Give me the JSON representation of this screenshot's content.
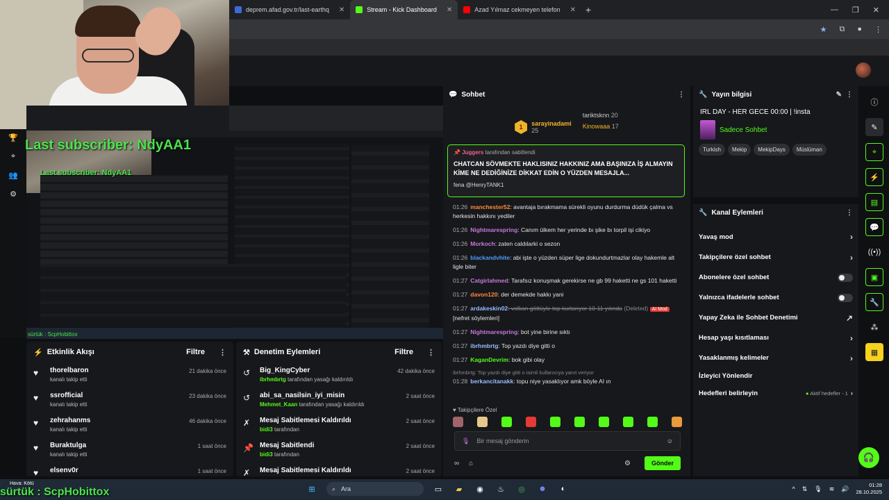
{
  "browser": {
    "tabs": [
      {
        "label": "deprem.afad.gov.tr/last-earthq",
        "color": "#3c6bd6"
      },
      {
        "label": "Stream - Kick Dashboard",
        "color": "#53fc18"
      },
      {
        "label": "Azad Yılmaz cekmeyen telefon",
        "color": "#ff0000"
      }
    ]
  },
  "overlay": {
    "last_subscriber": "Last subscriber: NdyAA1",
    "bottom_name": "sürtük : ScpHobittox"
  },
  "activity": {
    "title": "Etkinlik Akışı",
    "filter": "Filtre",
    "items": [
      {
        "name": "thorelbaron",
        "sub": "kanalı takip etti",
        "time": "21 dakika önce"
      },
      {
        "name": "ssrofficial",
        "sub": "kanalı takip etti",
        "time": "23 dakika önce"
      },
      {
        "name": "zehrahanms",
        "sub": "kanalı takip etti",
        "time": "46 dakika önce"
      },
      {
        "name": "Buraktulga",
        "sub": "kanalı takip etti",
        "time": "1 saat önce"
      },
      {
        "name": "elsenv0r",
        "sub": "",
        "time": "1 saat önce"
      }
    ]
  },
  "moderation": {
    "title": "Denetim Eylemleri",
    "filter": "Filtre",
    "items": [
      {
        "name": "Big_KingCyber",
        "actor": "ibrhmbrtg",
        "sub": "tarafından yasağı kaldırıldı",
        "time": "42 dakika önce",
        "icon": "undo-icon"
      },
      {
        "name": "abi_sa_nasilsin_iyi_misin",
        "actor": "Mehmet_Kaan",
        "sub": "tarafından yasağı kaldırıldı",
        "time": "2 saat önce",
        "icon": "undo-icon"
      },
      {
        "name": "Mesaj Sabitlemesi Kaldırıldı",
        "actor": "bidi3",
        "sub": "tarafından",
        "time": "2 saat önce",
        "icon": "unpin-icon"
      },
      {
        "name": "Mesaj Sabitlendi",
        "actor": "bidi3",
        "sub": "tarafından",
        "time": "2 saat önce",
        "icon": "pin-icon"
      },
      {
        "name": "Mesaj Sabitlemesi Kaldırıldı",
        "actor": "",
        "sub": "",
        "time": "2 saat önce",
        "icon": "unpin-icon"
      }
    ]
  },
  "chat": {
    "title": "Sohbet",
    "leader": {
      "first": {
        "name": "sarayinadami",
        "count": "25",
        "rank": "1"
      },
      "second": {
        "name": "tariktsknn",
        "count": "20"
      },
      "third": {
        "name": "Kinowaaa",
        "count": "17"
      }
    },
    "pinned": {
      "by_user": "Juggers",
      "by_text": "tarafından sabitlendi",
      "text": "CHATCAN SÖVMEKTE HAKLISINIZ HAKKINIZ AMA BAŞINIZA İŞ ALMAYIN KİME NE DEDİĞİNİZE DİKKAT EDİN O YÜZDEN MESAJLA...",
      "mention": "fena @HenryTANK1"
    },
    "messages": [
      {
        "time": "01:26",
        "user": "manchester52",
        "color": "#ff8a3d",
        "text": ": avantaja bırakmama sürekli oyunu durdurma düdük çalma vs herkesin hakkını yediler"
      },
      {
        "time": "01:26",
        "user": "Nightmarespring",
        "color": "#c678dd",
        "text": ": Canım ülkem her yerinde bı şike bı torpil işi cikiyo"
      },
      {
        "time": "01:26",
        "user": "Morkoch",
        "color": "#c678dd",
        "text": ": zaten caldılarki o sezon"
      },
      {
        "time": "01:26",
        "user": "blackandvhite",
        "color": "#4d9bff",
        "text": ": abi işte o yüzden süper lige dokundurtmazlar olay hakemle alt ligle biter"
      },
      {
        "time": "01:27",
        "user": "Catgirlahmed",
        "color": "#c678dd",
        "text": ": Tarafsız konuşmak gerekirse ne gb 99 haketti ne gs 101 haketti"
      },
      {
        "time": "01:27",
        "user": "davon120",
        "color": "#ff8a3d",
        "text": ": der demekde hakkı yani"
      },
      {
        "time": "01:27",
        "user": "ardakeskin02",
        "color": "#9bbcff",
        "deleted": ": volkan göttüyle top kurtarıyor 10-11 yılında",
        "note": "(Deleted)",
        "badge": "AI Mod",
        "extra": "[nefret söylemleri]"
      },
      {
        "time": "01:27",
        "user": "Nightmarespring",
        "color": "#c678dd",
        "text": ": bot yine birine sıktı"
      },
      {
        "time": "01:27",
        "user": "ibrhmbrtg",
        "color": "#9bbcff",
        "text": ": Top yazdı diye gitti o"
      },
      {
        "time": "01:27",
        "user": "KaganDevrim",
        "color": "#53fc18",
        "text": ": bok gibi olay"
      }
    ],
    "reply_hint": "ibrhmbrtg: Top yazdı diye gitti o isimli kullanıcıya yanıt veriyor",
    "last_message": {
      "time": "01:28",
      "user": "berkancitanakk",
      "color": "#9bbcff",
      "text": ": topu niye yasaklıyor amk böyle AI ın"
    },
    "emote_label": "Takipçilere Özel",
    "input_placeholder": "Bir mesaj gönderin",
    "send_label": "Gönder"
  },
  "stream_info": {
    "title": "Yayın bilgisi",
    "stream_title": "IRL DAY - HER GECE 00:00 | !insta",
    "category": "Sadece Sohbet",
    "tags": [
      "Turkish",
      "Mekip",
      "MekipDays",
      "Müslüman"
    ]
  },
  "channel_actions": {
    "title": "Kanal Eylemleri",
    "items": [
      {
        "label": "Yavaş mod",
        "control": "arrow"
      },
      {
        "label": "Takipçilere özel sohbet",
        "control": "arrow"
      },
      {
        "label": "Abonelere özel sohbet",
        "control": "toggle"
      },
      {
        "label": "Yalnızca ifadelerle sohbet",
        "control": "toggle"
      },
      {
        "label": "Yapay Zeka ile Sohbet Denetimi",
        "control": "external"
      },
      {
        "label": "Hesap yaşı kısıtlaması",
        "control": "arrow"
      },
      {
        "label": "Yasaklanmış kelimeler",
        "control": "arrow"
      },
      {
        "label": "İzleyici Yönlendir",
        "control": "none"
      },
      {
        "label": "Hedefleri belirleyin",
        "control": "goal"
      }
    ],
    "goal_status": "Aktif hedefler - 1"
  },
  "taskbar": {
    "weather_line1": "Hava: Kötü",
    "search": "Ara",
    "time": "01:28",
    "date": "28.10.2025"
  }
}
